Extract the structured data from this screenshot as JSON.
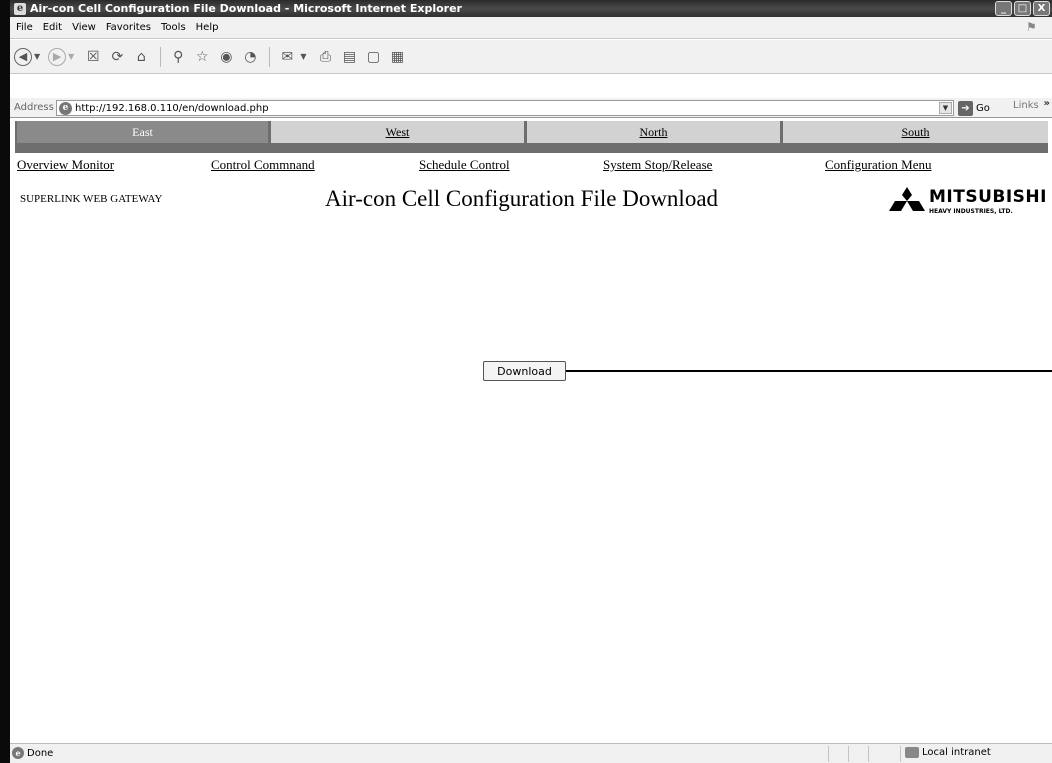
{
  "window": {
    "title": "Air-con Cell Configuration File Download - Microsoft Internet Explorer",
    "controls": {
      "minimize": "_",
      "maximize": "□",
      "close": "X"
    }
  },
  "menubar": {
    "items": [
      "File",
      "Edit",
      "View",
      "Favorites",
      "Tools",
      "Help"
    ]
  },
  "addressbar": {
    "label": "Address",
    "url": "http://192.168.0.110/en/download.php",
    "go_label": "Go",
    "links_label": "Links"
  },
  "region_tabs": [
    {
      "label": "East",
      "active": true
    },
    {
      "label": "West",
      "active": false
    },
    {
      "label": "North",
      "active": false
    },
    {
      "label": "South",
      "active": false
    }
  ],
  "nav_links": [
    "Overview Monitor",
    "Control Commnand",
    "Schedule Control",
    "System Stop/Release",
    "Configuration Menu"
  ],
  "header": {
    "gateway_label": "SUPERLINK WEB GATEWAY",
    "page_title": "Air-con Cell Configuration File Download",
    "logo_brand": "MITSUBISHI",
    "logo_sub": "HEAVY INDUSTRIES, LTD."
  },
  "main": {
    "download_label": "Download"
  },
  "statusbar": {
    "status": "Done",
    "zone": "Local intranet"
  }
}
